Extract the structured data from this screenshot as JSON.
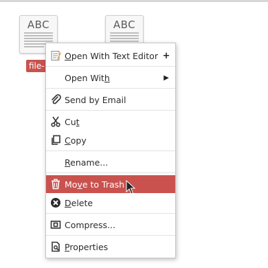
{
  "desktop": {
    "files": [
      {
        "thumb_text": "ABC"
      },
      {
        "thumb_text": "ABC"
      }
    ],
    "selected_file_label": "file-1"
  },
  "context_menu": {
    "items": [
      {
        "pre": "",
        "u": "O",
        "post": "pen With Text Editor",
        "icon": "text-editor-icon",
        "suffix": "+"
      },
      {
        "pre": "Open Wit",
        "u": "h",
        "post": "",
        "icon": "",
        "suffix": "submenu-arrow"
      },
      {
        "pre": "Send by Email",
        "u": "",
        "post": "",
        "icon": "paperclip-icon",
        "suffix": ""
      },
      {
        "pre": "Cu",
        "u": "t",
        "post": "",
        "icon": "scissors-icon",
        "suffix": ""
      },
      {
        "pre": "",
        "u": "C",
        "post": "opy",
        "icon": "copy-icon",
        "suffix": ""
      },
      {
        "pre": "",
        "u": "R",
        "post": "ename...",
        "icon": "",
        "suffix": ""
      },
      {
        "pre": "Mo",
        "u": "v",
        "post": "e to Trash",
        "icon": "trash-icon",
        "suffix": "",
        "highlighted": true
      },
      {
        "pre": "",
        "u": "D",
        "post": "elete",
        "icon": "delete-icon",
        "suffix": ""
      },
      {
        "pre": "Compress...",
        "u": "",
        "post": "",
        "icon": "compress-icon",
        "suffix": ""
      },
      {
        "pre": "",
        "u": "P",
        "post": "roperties",
        "icon": "properties-icon",
        "suffix": ""
      }
    ]
  },
  "colors": {
    "highlight": "#c9524f",
    "menu_border": "#c4c4c4"
  }
}
